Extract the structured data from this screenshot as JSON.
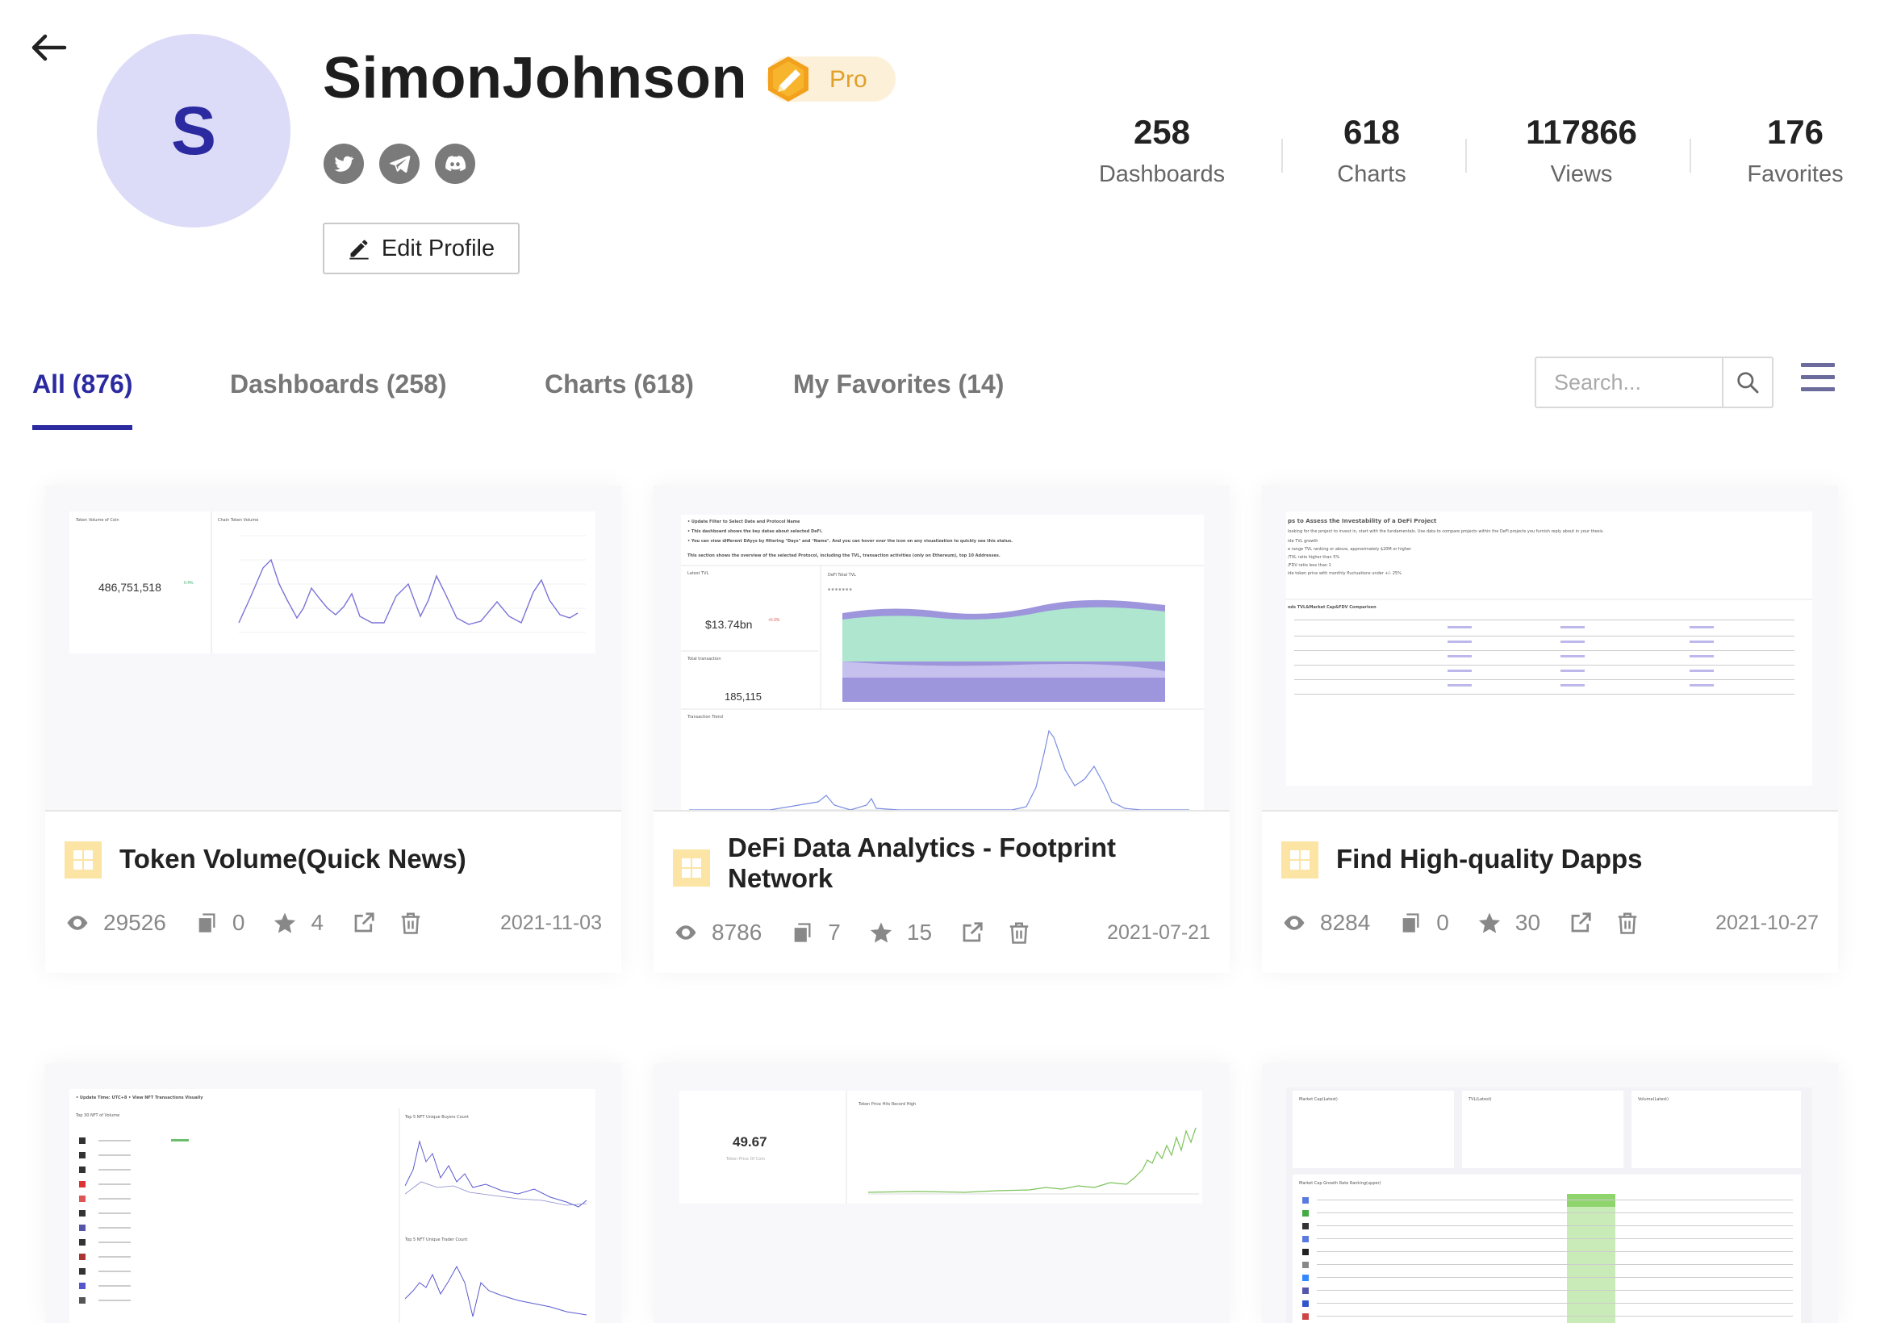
{
  "profile": {
    "initial": "S",
    "username": "SimonJohnson",
    "badge": "Pro",
    "edit_label": "Edit Profile",
    "social": [
      "twitter-icon",
      "telegram-icon",
      "discord-icon"
    ]
  },
  "stats": [
    {
      "value": "258",
      "label": "Dashboards"
    },
    {
      "value": "618",
      "label": "Charts"
    },
    {
      "value": "117866",
      "label": "Views"
    },
    {
      "value": "176",
      "label": "Favorites"
    }
  ],
  "tabs": [
    {
      "label": "All (876)",
      "active": true
    },
    {
      "label": "Dashboards (258)",
      "active": false
    },
    {
      "label": "Charts (618)",
      "active": false
    },
    {
      "label": "My Favorites (14)",
      "active": false
    }
  ],
  "search": {
    "placeholder": "Search..."
  },
  "colors": {
    "accent": "#2b2aa0",
    "pro": "#e0a02a",
    "avatar_bg": "#dcdcf8"
  },
  "cards": [
    {
      "title": "Token Volume(Quick News)",
      "views": "29526",
      "copies": "0",
      "stars": "4",
      "date": "2021-11-03",
      "thumb": {
        "label_left": "Token Volume of Coin",
        "label_right": "Chain Token Volume",
        "big_number": "486,751,518",
        "delta": "0.4%"
      }
    },
    {
      "title": "DeFi Data Analytics - Footprint Network",
      "views": "8786",
      "copies": "7",
      "stars": "15",
      "date": "2021-07-21",
      "thumb": {
        "line1": "• Update Filter to Select Date and Protocol Name",
        "line2": "• This dashboard shows the key datas about selected DeFi.",
        "line3": "• You can view different DAyys by filtering \"Days\" and \"Name\". And you can hover over the icon on any visualization to quickly see this status.",
        "line4": "This section shows the overview of the selected Protocol, including the TVL, transaction activities (only on Ethereum), top 10 Addresses.",
        "tvl_label": "Latest TVL",
        "tvl": "$13.74bn",
        "tvl_delta": "+5.9%",
        "tx_label": "Total transaction",
        "tx": "185,115",
        "chart1": "DeFi Total TVL",
        "chart2": "Transaction Trend"
      }
    },
    {
      "title": "Find High-quality Dapps",
      "views": "8284",
      "copies": "0",
      "stars": "30",
      "date": "2021-10-27",
      "thumb": {
        "heading": "ps to Assess the Investability of a DeFi Project",
        "sub": "looking for the project to invest in, start with the fundamentals. Use data to compare projects within the DeFi projects you furnish reply about in your thesis.",
        "b1": "ide TVL growth",
        "b2": "e range TVL ranking or above, approximately $20M or higher",
        "b3": "/TVL ratio higher than 5%",
        "b4": "/FDV ratio less than 1",
        "b5": "ide token price with monthly fluctuations under +/- 25%",
        "table_title": "ods TVL&Market Cap&FDV Comparison"
      }
    },
    {
      "thumb": {
        "header": "• Update Time: UTC+8 • View NFT Transactions Visually",
        "t1": "Top 30 NFT of Volume",
        "t2": "Top 5 NFT Unique Buyers Count",
        "t3": "Top 5 NFT Unique Trader Count"
      }
    },
    {
      "thumb": {
        "big_number": "49.67",
        "label": "Token Price Of Coin",
        "chart": "Token Price Hits Record High"
      }
    },
    {
      "thumb": {
        "c1": "Market Cap(Latest)",
        "c2": "TVL(Latest)",
        "c3": "Volume(Latest)",
        "table": "Market Cap Growth Rate Ranking(upper)"
      }
    }
  ]
}
